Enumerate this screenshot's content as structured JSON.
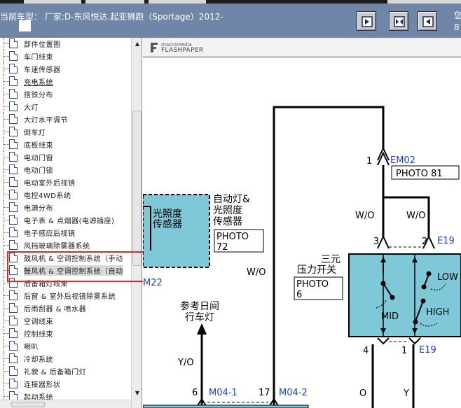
{
  "header": {
    "title": "当前车型：  厂家:D-东风悦达.起亚狮跑（Sportage）2012-",
    "user_line1": "您",
    "user_line2": "87",
    "buttons": [
      "prev-page",
      "fit-page",
      "next-page"
    ]
  },
  "tree": {
    "items": [
      {
        "label": "部件位置图"
      },
      {
        "label": "车门线束"
      },
      {
        "label": "车速传感器"
      },
      {
        "label": "充电系统",
        "link": true
      },
      {
        "label": "搭铁分布"
      },
      {
        "label": "大灯"
      },
      {
        "label": "大灯水平调节"
      },
      {
        "label": "倒车灯"
      },
      {
        "label": "底板线束"
      },
      {
        "label": "电动门窗"
      },
      {
        "label": "电动门锁"
      },
      {
        "label": "电动室外后视镜"
      },
      {
        "label": "电控4WD系统"
      },
      {
        "label": "电源分布"
      },
      {
        "label": "电子表 & 点烟器(电源插座)"
      },
      {
        "label": "电子感应后视镜"
      },
      {
        "label": "风挡玻璃除雾器系统"
      },
      {
        "label": "鼓风机 & 空调控制系统（手动"
      },
      {
        "label": "鼓风机 & 空调控制系统（自动",
        "selected": true
      },
      {
        "label": "后备箱灯线束"
      },
      {
        "label": "后窗 & 室外后视镜除雾系统"
      },
      {
        "label": "后雨刮器 & 喷水器"
      },
      {
        "label": "空调线束"
      },
      {
        "label": "控制线束"
      },
      {
        "label": "喇叭"
      },
      {
        "label": "冷却系统"
      },
      {
        "label": "礼貌 & 后备箱门灯"
      },
      {
        "label": "连接器形状"
      },
      {
        "label": "起动系统"
      }
    ]
  },
  "viewer": {
    "brand_small": "macromedia",
    "brand_big": "FLASHPAPER"
  },
  "diagram": {
    "sensor_box_text": [
      "光照度",
      "传感器"
    ],
    "sensor_label": [
      "自动灯&",
      "光照度",
      "传感器"
    ],
    "sensor_photo": [
      "PHOTO",
      "72"
    ],
    "m22": "M22",
    "em02_pin": "1",
    "em02": "EM02",
    "photo81": "PHOTO 81",
    "wire_wo_1": "W/O",
    "wire_wo_2": "W/O",
    "wire_wo_3": "W/O",
    "pin3": "3",
    "pin2": "2",
    "e19_top": "E19",
    "switch_label": [
      "三元",
      "压力开关"
    ],
    "switch_photo": [
      "PHOTO",
      "6"
    ],
    "low": "LOW",
    "mid": "MID",
    "high": "HIGH",
    "pin4": "4",
    "pin1": "1",
    "e19_bottom": "E19",
    "daylight_label": [
      "参考日间",
      "行车灯"
    ],
    "wire_yo": "Y/O",
    "pin6": "6",
    "m04_1": "M04-1",
    "pin17": "17",
    "m04_2": "M04-2",
    "wire_o": "O",
    "wire_y": "Y",
    "colors": {
      "sensor_fill": "#7ec8d8",
      "switch_fill": "#7ec8d8",
      "pin_blue": "#1c3ec6"
    }
  }
}
